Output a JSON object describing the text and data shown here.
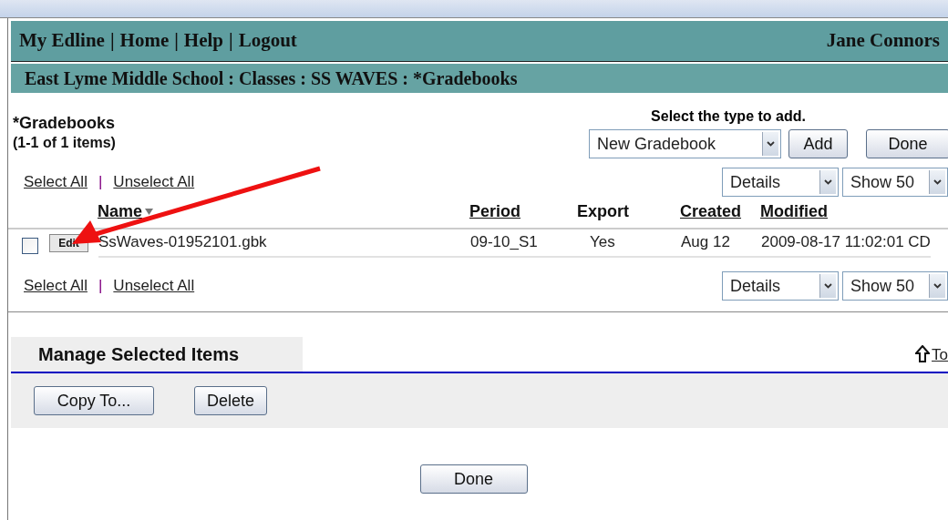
{
  "nav": {
    "links": [
      "My Edline",
      "Home",
      "Help",
      "Logout"
    ],
    "separator": "|",
    "user": "Jane Connors"
  },
  "breadcrumb": "East Lyme Middle School : Classes : SS WAVES : *Gradebooks",
  "heading": {
    "title": "*Gradebooks",
    "count": "(1-1 of 1 items)"
  },
  "add": {
    "label": "Select the type to add.",
    "type_select": "New Gradebook",
    "add_button": "Add",
    "done_button": "Done"
  },
  "list_controls_top": {
    "select_all": "Select All",
    "separator": "|",
    "unselect_all": "Unselect All",
    "view_select": "Details",
    "page_size_select": "Show 50"
  },
  "table": {
    "columns": [
      {
        "label": "Name",
        "sortable": true,
        "sorted": true
      },
      {
        "label": "Period",
        "sortable": true,
        "sorted": false
      },
      {
        "label": "Export",
        "sortable": false,
        "sorted": false
      },
      {
        "label": "Created",
        "sortable": true,
        "sorted": false
      },
      {
        "label": "Modified",
        "sortable": true,
        "sorted": false
      }
    ],
    "rows": [
      {
        "checked": false,
        "edit": "Edit",
        "name": "SsWaves-01952101.gbk",
        "period": "09-10_S1",
        "export": "Yes",
        "created": "Aug 12",
        "modified": "2009-08-17 11:02:01 CD"
      }
    ]
  },
  "list_controls_bottom": {
    "select_all": "Select All",
    "separator": "|",
    "unselect_all": "Unselect All",
    "view_select": "Details",
    "page_size_select": "Show 50"
  },
  "manage": {
    "title": "Manage Selected Items",
    "top_link": "To",
    "buttons": [
      "Copy To...",
      "Delete"
    ]
  },
  "footer_button": "Done"
}
